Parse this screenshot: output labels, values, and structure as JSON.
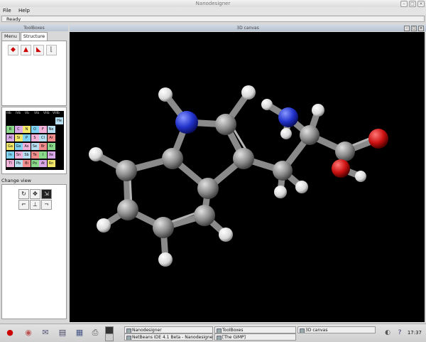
{
  "window": {
    "title": "Nanodesigner"
  },
  "menu": {
    "items": [
      "File",
      "Help"
    ]
  },
  "status": {
    "text": "Ready"
  },
  "toolboxes": {
    "title": "ToolBoxes",
    "tabs": [
      "Menu",
      "Structure"
    ],
    "active_tab": "Structure",
    "tools": [
      "bond-tool-icon",
      "atom-tool-icon",
      "select-tool-icon",
      "erase-tool-icon"
    ]
  },
  "periodic_table": {
    "group_headers": [
      "IIIb",
      "IVb",
      "Vb",
      "VIb",
      "VIIb",
      "VIIIb"
    ],
    "rows": [
      [
        "",
        "",
        "",
        "",
        "",
        "",
        "He"
      ],
      [
        "B",
        "C",
        "N",
        "O",
        "F",
        "Ne",
        ""
      ],
      [
        "Al",
        "Si",
        "P",
        "S",
        "Cl",
        "Ar",
        ""
      ],
      [
        "Ga",
        "Ge",
        "As",
        "Se",
        "Br",
        "Kr",
        ""
      ],
      [
        "In",
        "Sn",
        "Sb",
        "Te",
        "I",
        "Xe",
        ""
      ],
      [
        "Tl",
        "Pb",
        "Bi",
        "Po",
        "At",
        "Rn",
        ""
      ]
    ]
  },
  "change_view": {
    "label": "Change view"
  },
  "canvas": {
    "title": "3D canvas",
    "molecule": "tryptophan"
  },
  "taskbar": {
    "tasks": [
      {
        "label": "Nanodesigner"
      },
      {
        "label": "NetBeans IDE 4.1 Beta - Nanodesigner"
      },
      {
        "label": "ToolBoxes"
      },
      {
        "label": "[The GIMP]"
      },
      {
        "label": "3D canvas"
      }
    ],
    "clock": "17:37"
  },
  "colors": {
    "carbon": "#8c8c8c",
    "nitrogen": "#2233cc",
    "oxygen": "#cc1111",
    "hydrogen": "#e8e8e8",
    "canvas_bg": "#000000"
  }
}
